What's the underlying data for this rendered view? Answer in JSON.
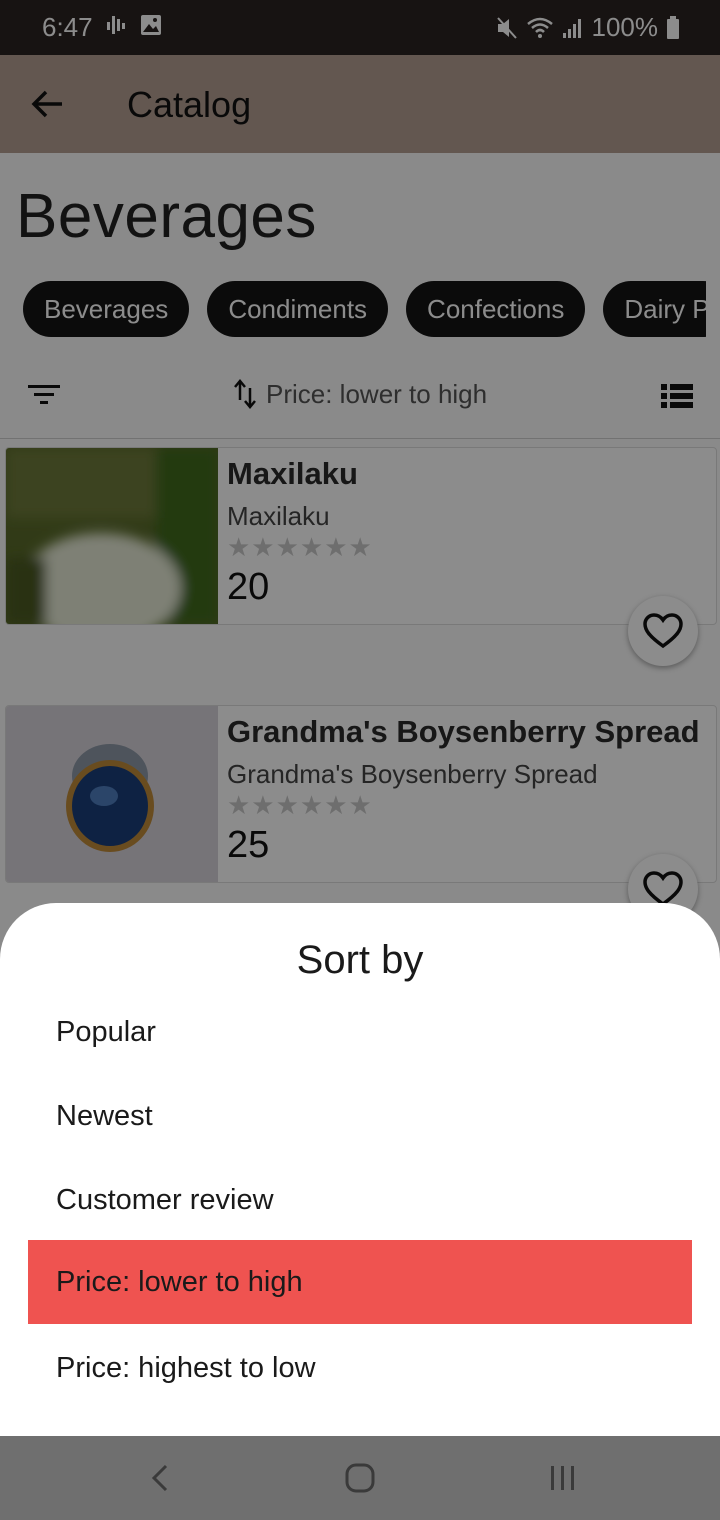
{
  "status_bar": {
    "time": "6:47",
    "battery": "100%"
  },
  "app_bar": {
    "title": "Catalog",
    "back_icon": "arrow-back-icon"
  },
  "page": {
    "title": "Beverages"
  },
  "categories": [
    "Beverages",
    "Condiments",
    "Confections",
    "Dairy P"
  ],
  "sort_bar": {
    "filter_icon": "filter-icon",
    "sort_icon": "swap-vertical-icon",
    "current_sort": "Price: lower to high",
    "view_icon": "list-view-icon"
  },
  "products": [
    {
      "name": "Maxilaku",
      "subtitle": "Maxilaku",
      "stars": "★★★★★★",
      "price": "20"
    },
    {
      "name": "Grandma's Boysenberry Spread",
      "subtitle": "Grandma's Boysenberry Spread",
      "stars": "★★★★★★",
      "price": "25"
    }
  ],
  "sort_sheet": {
    "title": "Sort by",
    "options": [
      "Popular",
      "Newest",
      "Customer review",
      "Price: lower to high",
      "Price: highest to low"
    ],
    "selected": "Price: lower to high"
  },
  "colors": {
    "app_bar": "#b49f92",
    "selected_option": "#ef5350",
    "chip": "#151515"
  }
}
